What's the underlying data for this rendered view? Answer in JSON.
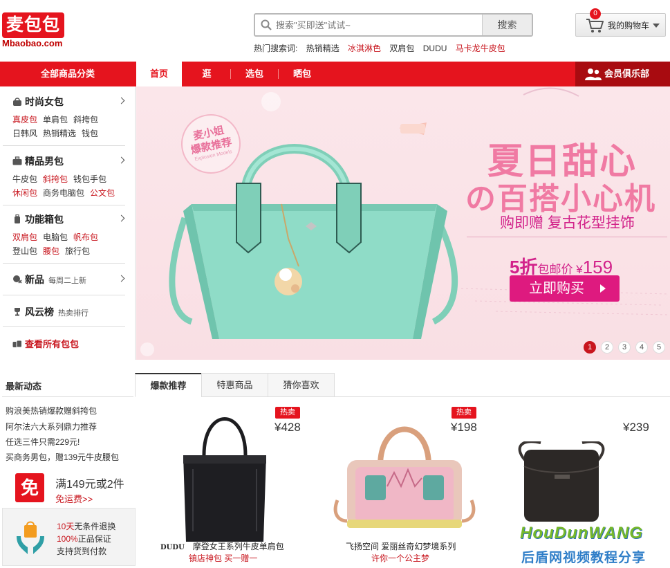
{
  "header": {
    "logo_text": "麦包包",
    "logo_sub": "Mbaobao.com",
    "search": {
      "placeholder": "搜索\"买即送\"试试~",
      "button": "搜索"
    },
    "hot_label": "热门搜索词:",
    "hot_terms": [
      {
        "text": "热销精选",
        "color": "#333333"
      },
      {
        "text": "冰淇淋色",
        "color": "#c8161e"
      },
      {
        "text": "双肩包",
        "color": "#333333"
      },
      {
        "text": "DUDU",
        "color": "#333333"
      },
      {
        "text": "马卡龙牛皮包",
        "color": "#c8161e"
      }
    ],
    "cart": {
      "count": "0",
      "label": "我的购物车"
    }
  },
  "nav": {
    "all_categories": "全部商品分类",
    "links": [
      "首页",
      "逛",
      "选包",
      "晒包"
    ],
    "club": "会员俱乐部"
  },
  "sidebar": {
    "categories": [
      {
        "title": "时尚女包",
        "rows": [
          [
            {
              "t": "真皮包",
              "red": true
            },
            {
              "t": "单肩包",
              "red": false
            },
            {
              "t": "斜挎包",
              "red": false
            }
          ],
          [
            {
              "t": "日韩风",
              "red": false
            },
            {
              "t": "热销精选",
              "red": false
            },
            {
              "t": "钱包",
              "red": false
            }
          ]
        ]
      },
      {
        "title": "精品男包",
        "rows": [
          [
            {
              "t": "牛皮包",
              "red": false
            },
            {
              "t": "斜挎包",
              "red": true
            },
            {
              "t": "钱包手包",
              "red": false
            }
          ],
          [
            {
              "t": "休闲包",
              "red": true
            },
            {
              "t": "商务电脑包",
              "red": false
            },
            {
              "t": "公文包",
              "red": true
            }
          ]
        ]
      },
      {
        "title": "功能箱包",
        "rows": [
          [
            {
              "t": "双肩包",
              "red": true
            },
            {
              "t": "电脑包",
              "red": false
            },
            {
              "t": "帆布包",
              "red": true
            }
          ],
          [
            {
              "t": "登山包",
              "red": false
            },
            {
              "t": "腰包",
              "red": true
            },
            {
              "t": "旅行包",
              "red": false
            }
          ]
        ]
      }
    ],
    "new": {
      "title": "新品",
      "note": "每周二上新"
    },
    "rank": {
      "title": "风云榜",
      "note": "热卖排行"
    },
    "all": "查看所有包包"
  },
  "banner": {
    "stamp": "麦小姐\n爆款推荐",
    "stamp_small": "Explosion Models",
    "headline1": "夏日甜心",
    "headline2": "の百搭小心机",
    "headline3": "购即赠 复古花型挂饰",
    "discount": "5折",
    "price_mid": "包邮价 ¥",
    "price_num": "159",
    "buy_button": "立即购买",
    "pages": [
      "1",
      "2",
      "3",
      "4",
      "5"
    ],
    "active_page": 0,
    "bag_color": "#8fdcc7"
  },
  "news": {
    "title": "最新动态",
    "items": [
      {
        "text": "购浪美热销爆款赠斜挎包",
        "red": true
      },
      {
        "text": "阿尔法六大系列鼎力推荐",
        "red": false
      },
      {
        "text": "任选三件只需229元!",
        "red": false
      },
      {
        "text": "买商务男包，赠139元牛皮腰包",
        "red": false
      }
    ],
    "free_icon": "免",
    "free_title": "满149元或2件",
    "free_sub": "免运费>>",
    "guarantee": [
      {
        "text": "10天无条件退换",
        "prefix": "10天"
      },
      {
        "text": "100%正品保证",
        "prefix": "100%"
      },
      {
        "text": "支持货到付款",
        "prefix": ""
      }
    ]
  },
  "tabs": [
    "爆款推荐",
    "特惠商品",
    "猜你喜欢"
  ],
  "products": [
    {
      "hot": "热卖",
      "price": "¥428",
      "name": "摩登女王系列牛皮单肩包",
      "brand": "DUDU",
      "sub": "镇店神包  买一赠一",
      "bag_color": "#1e1e22"
    },
    {
      "hot": "热卖",
      "price": "¥198",
      "name": "飞扬空间  爱丽丝奇幻梦境系列",
      "brand": "",
      "sub": "许你一个公主梦",
      "bag_color": "#d9a07d"
    },
    {
      "hot": "",
      "price": "¥239",
      "name": "",
      "brand": "",
      "sub": "",
      "bag_color": "#2c2826"
    }
  ],
  "watermark": {
    "top": "HouDunWANG",
    "bottom": "后盾网视频教程分享"
  }
}
